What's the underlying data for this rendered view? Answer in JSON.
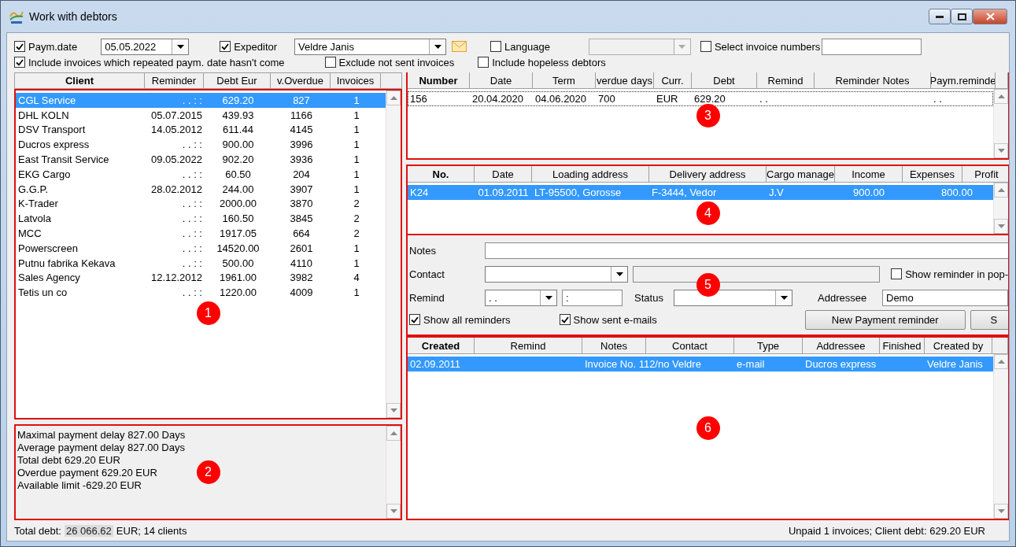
{
  "window": {
    "title": "Work with debtors"
  },
  "filters": {
    "payment_date": {
      "label": "Paym.date",
      "checked": true,
      "value": "05.05.2022"
    },
    "expeditor": {
      "label": "Expeditor",
      "checked": true,
      "value": "Veldre Janis"
    },
    "language": {
      "label": "Language",
      "checked": false,
      "disabled": true
    },
    "select_invoice_numbers": {
      "label": "Select invoice numbers",
      "checked": false
    },
    "include_repeated": {
      "label": "Include invoices which repeated paym. date hasn't come",
      "checked": true
    },
    "exclude_not_sent": {
      "label": "Exclude not sent invoices",
      "checked": false
    },
    "include_hopeless": {
      "label": "Include hopeless debtors",
      "checked": false
    }
  },
  "clients": {
    "marker": "1",
    "columns": [
      "Client",
      "Reminder",
      "Debt Eur",
      "v.Overdue",
      "Invoices"
    ],
    "rows": [
      {
        "selected": true,
        "cells": [
          "CGL Service",
          ". .   : :",
          "629.20",
          "827",
          "1"
        ]
      },
      {
        "selected": false,
        "cells": [
          "DHL KOLN",
          "05.07.2015",
          "439.93",
          "1166",
          "1"
        ]
      },
      {
        "selected": false,
        "cells": [
          "DSV Transport",
          "14.05.2012",
          "611.44",
          "4145",
          "1"
        ]
      },
      {
        "selected": false,
        "cells": [
          "Ducros express",
          ". .   : :",
          "900.00",
          "3996",
          "1"
        ]
      },
      {
        "selected": false,
        "cells": [
          "East Transit Service",
          "09.05.2022",
          "902.20",
          "3936",
          "1"
        ]
      },
      {
        "selected": false,
        "cells": [
          "EKG Cargo",
          ". .   : :",
          "60.50",
          "204",
          "1"
        ]
      },
      {
        "selected": false,
        "cells": [
          "G.G.P.",
          "28.02.2012",
          "244.00",
          "3907",
          "1"
        ]
      },
      {
        "selected": false,
        "cells": [
          "K-Trader",
          ". .   : :",
          "2000.00",
          "3870",
          "2"
        ]
      },
      {
        "selected": false,
        "cells": [
          "Latvola",
          ". .   : :",
          "160.50",
          "3845",
          "2"
        ]
      },
      {
        "selected": false,
        "cells": [
          "MCC",
          ". .   : :",
          "1917.05",
          "664",
          "2"
        ]
      },
      {
        "selected": false,
        "cells": [
          "Powerscreen",
          ". .   : :",
          "14520.00",
          "2601",
          "1"
        ]
      },
      {
        "selected": false,
        "cells": [
          "Putnu fabrika Kekava",
          ". .   : :",
          "500.00",
          "4110",
          "1"
        ]
      },
      {
        "selected": false,
        "cells": [
          "Sales Agency",
          "12.12.2012",
          "1961.00",
          "3982",
          "4"
        ]
      },
      {
        "selected": false,
        "cells": [
          "Tetis un co",
          ". .   : :",
          "1220.00",
          "4009",
          "1"
        ]
      }
    ]
  },
  "summary": {
    "marker": "2",
    "lines": [
      "Maximal payment delay 827.00 Days",
      "Average payment delay 827.00 Days",
      "Total debt 629.20 EUR",
      "Overdue payment 629.20 EUR",
      "Available limit -629.20 EUR"
    ]
  },
  "invoices": {
    "marker": "3",
    "columns": [
      "Number",
      "Date",
      "Term",
      "verdue days",
      "Curr.",
      "Debt",
      "Remind",
      "Reminder Notes",
      "Paym.reminde"
    ],
    "rows": [
      {
        "focused": true,
        "cells": [
          "156",
          "20.04.2020",
          "04.06.2020",
          "700",
          "EUR",
          "629.20",
          ". .",
          null,
          ". ."
        ]
      }
    ]
  },
  "trips": {
    "marker": "4",
    "columns": [
      "No.",
      "Date",
      "Loading address",
      "Delivery address",
      "Cargo manage",
      "Income",
      "Expenses",
      "Profit"
    ],
    "rows": [
      {
        "selected": true,
        "cells": [
          "K24",
          "01.09.2011",
          "LT-95500, Gorosse",
          "F-3444, Vedor",
          "J.V",
          "900.00",
          "800.00",
          null
        ]
      }
    ]
  },
  "reminder_form": {
    "marker": "5",
    "notes_label": "Notes",
    "contact_label": "Contact",
    "remind_label": "Remind",
    "remind_date": ". .",
    "remind_time": ":",
    "status_label": "Status",
    "addressee_label": "Addressee",
    "addressee": "Demo",
    "show_popup": {
      "label": "Show reminder in pop-",
      "checked": false
    },
    "show_all": {
      "label": "Show all reminders",
      "checked": true
    },
    "show_sent": {
      "label": "Show sent e-mails",
      "checked": true
    },
    "buttons": [
      "New Payment reminder",
      "S"
    ]
  },
  "reminders": {
    "marker": "6",
    "columns": [
      "Created",
      "Remind",
      "Notes",
      "Contact",
      "Type",
      "Addressee",
      "Finished",
      "Created by"
    ],
    "rows": [
      {
        "selected": true,
        "cells": [
          "02.09.2011",
          null,
          "Invoice No. 112/no Veldre",
          null,
          "e-mail",
          "Ducros express",
          null,
          "Veldre Janis"
        ]
      }
    ]
  },
  "status_bar": {
    "total_label": "Total debt:",
    "total_value": "26 066.62",
    "total_suffix": "EUR; 14  clients",
    "client_info": "Unpaid 1 invoices; Client debt: 629.20 EUR"
  }
}
